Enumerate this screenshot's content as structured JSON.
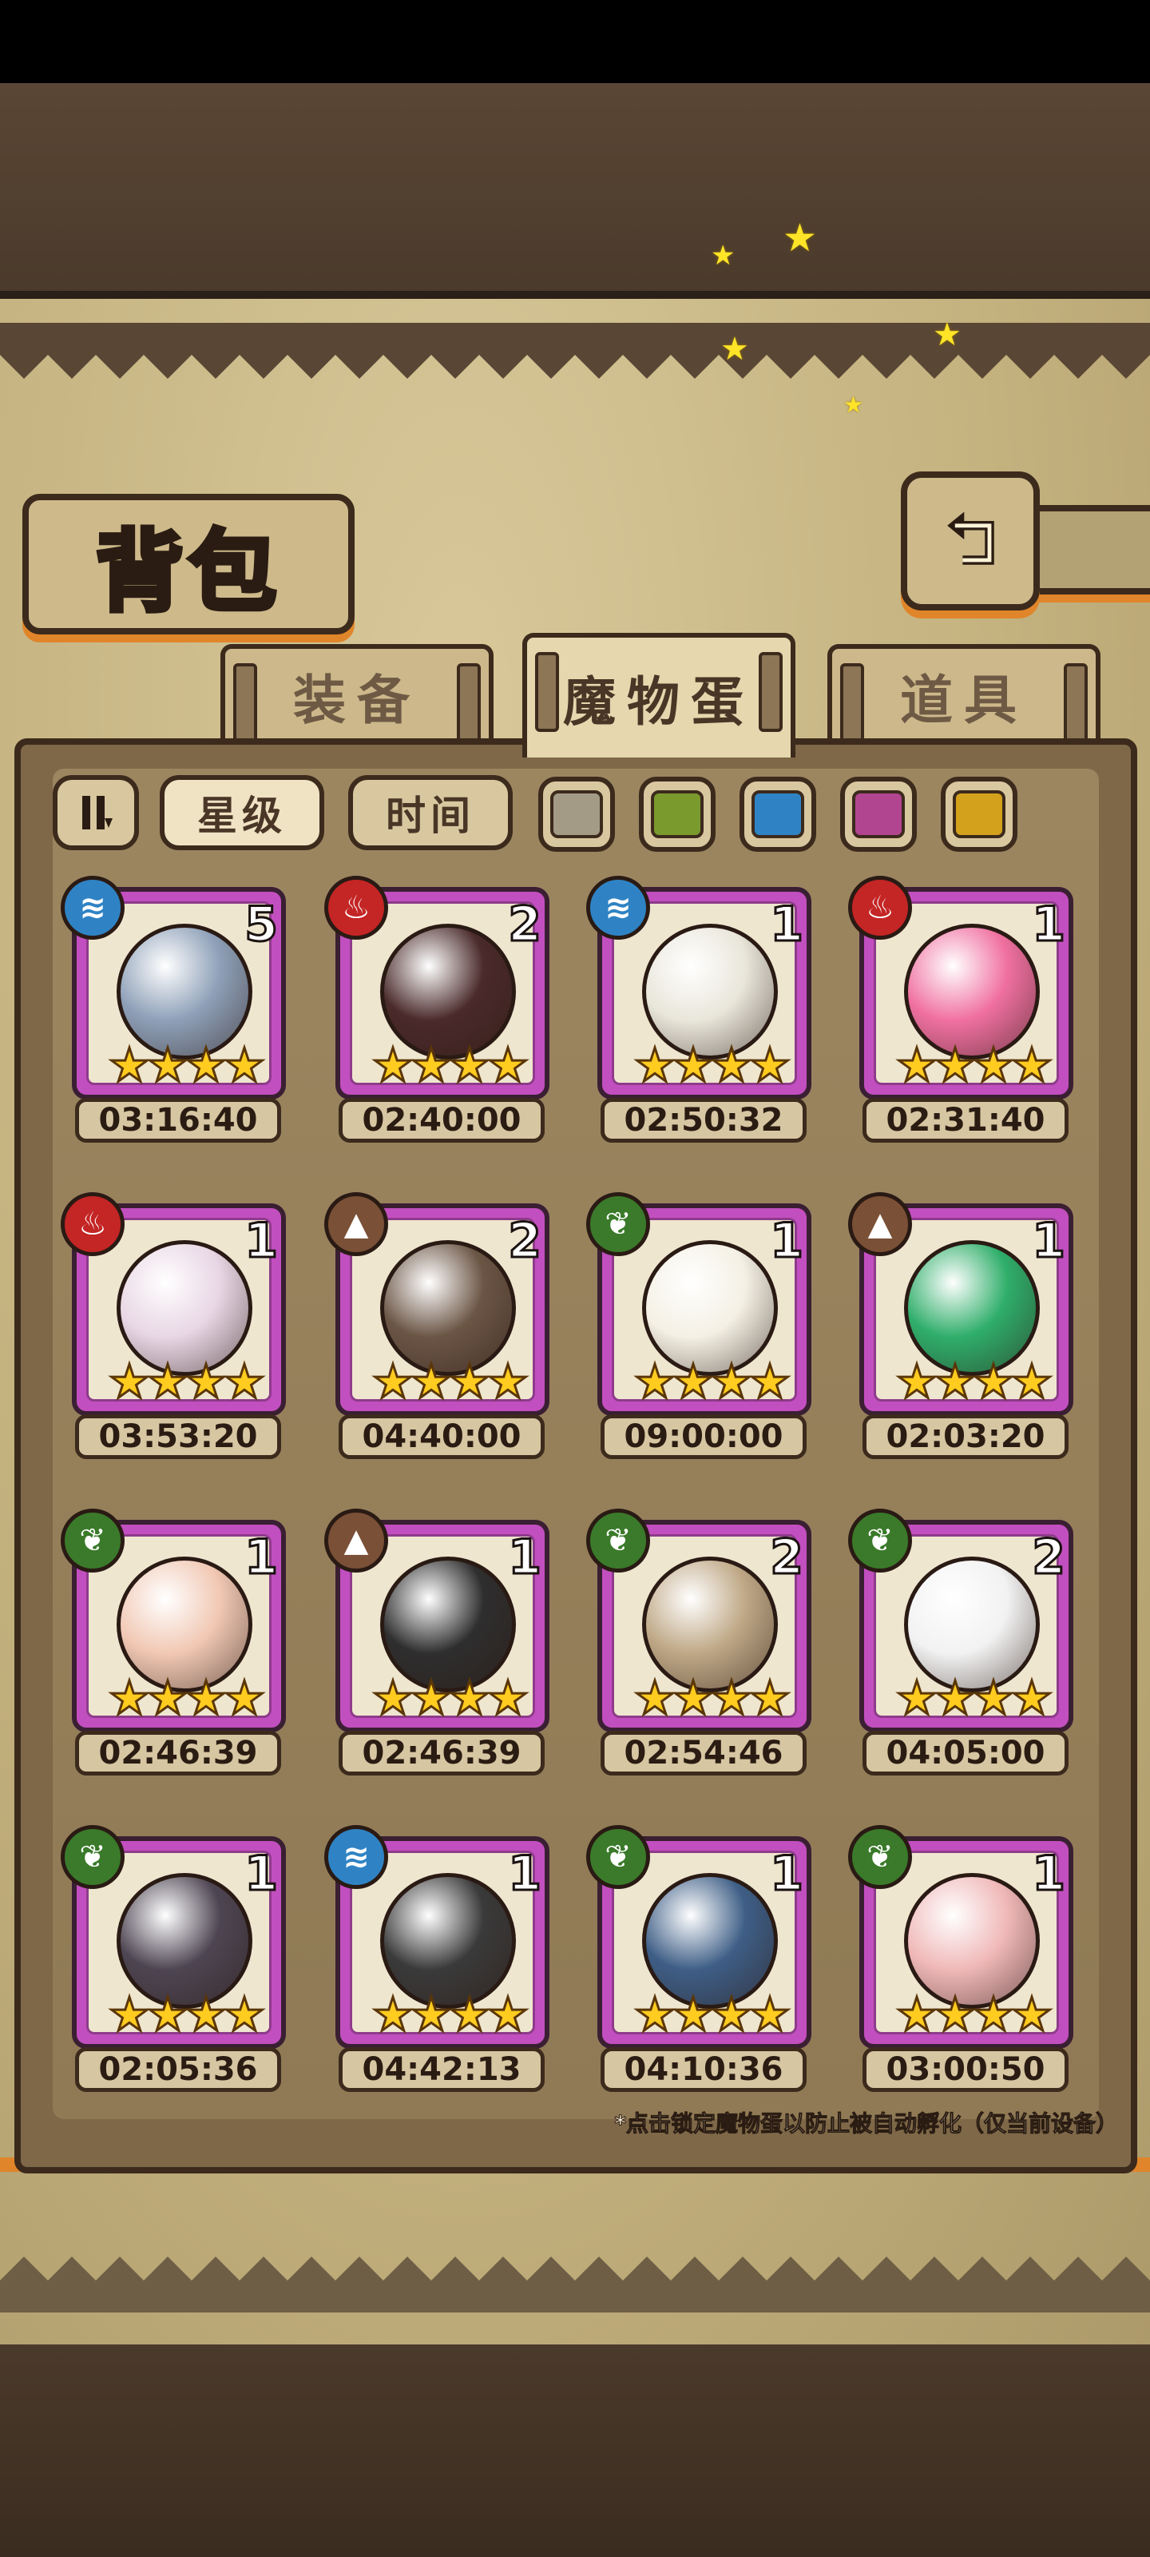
{
  "header": {
    "title": "背包",
    "back_icon": "back-arrow-icon"
  },
  "tabs": [
    {
      "label": "装备",
      "active": false
    },
    {
      "label": "魔物蛋",
      "active": true
    },
    {
      "label": "道具",
      "active": false
    }
  ],
  "filters": {
    "toggle_icon": "pause-sort-icon",
    "sort_star": "星级",
    "sort_time": "时间",
    "colors": [
      "#a39b86",
      "#7a9a2e",
      "#2f83c4",
      "#b2458f",
      "#d4a11c"
    ]
  },
  "eggs": [
    {
      "element": "water",
      "count": "5",
      "stars": 4,
      "time": "03:16:40",
      "color": "#8ea0b8"
    },
    {
      "element": "fire",
      "count": "2",
      "stars": 4,
      "time": "02:40:00",
      "color": "#4a2a2a"
    },
    {
      "element": "water",
      "count": "1",
      "stars": 4,
      "time": "02:50:32",
      "color": "#e9e6da"
    },
    {
      "element": "fire",
      "count": "1",
      "stars": 4,
      "time": "02:31:40",
      "color": "#f070a0"
    },
    {
      "element": "fire",
      "count": "1",
      "stars": 4,
      "time": "03:53:20",
      "color": "#e8d6e4"
    },
    {
      "element": "earth",
      "count": "2",
      "stars": 4,
      "time": "04:40:00",
      "color": "#6b5545"
    },
    {
      "element": "grass",
      "count": "1",
      "stars": 4,
      "time": "09:00:00",
      "color": "#f4f0e4"
    },
    {
      "element": "earth",
      "count": "1",
      "stars": 4,
      "time": "02:03:20",
      "color": "#2fae6a"
    },
    {
      "element": "grass",
      "count": "1",
      "stars": 4,
      "time": "02:46:39",
      "color": "#f1c8b4"
    },
    {
      "element": "earth",
      "count": "1",
      "stars": 4,
      "time": "02:46:39",
      "color": "#2e2e2e"
    },
    {
      "element": "grass",
      "count": "2",
      "stars": 4,
      "time": "02:54:46",
      "color": "#bfa886"
    },
    {
      "element": "grass",
      "count": "2",
      "stars": 4,
      "time": "04:05:00",
      "color": "#f2f2f2"
    },
    {
      "element": "grass",
      "count": "1",
      "stars": 4,
      "time": "02:05:36",
      "color": "#4d4552"
    },
    {
      "element": "water",
      "count": "1",
      "stars": 4,
      "time": "04:42:13",
      "color": "#3a3a3a"
    },
    {
      "element": "grass",
      "count": "1",
      "stars": 4,
      "time": "04:10:36",
      "color": "#3e5e86"
    },
    {
      "element": "grass",
      "count": "1",
      "stars": 4,
      "time": "03:00:50",
      "color": "#f0b8b8"
    }
  ],
  "element_colors": {
    "water": "#2f83c4",
    "fire": "#c42525",
    "earth": "#7a5036",
    "grass": "#3a7a2a"
  },
  "element_glyphs": {
    "water": "≋",
    "fire": "♨",
    "earth": "▲",
    "grass": "❦"
  },
  "note": "*点击锁定魔物蛋以防止被自动孵化（仅当前设备）"
}
